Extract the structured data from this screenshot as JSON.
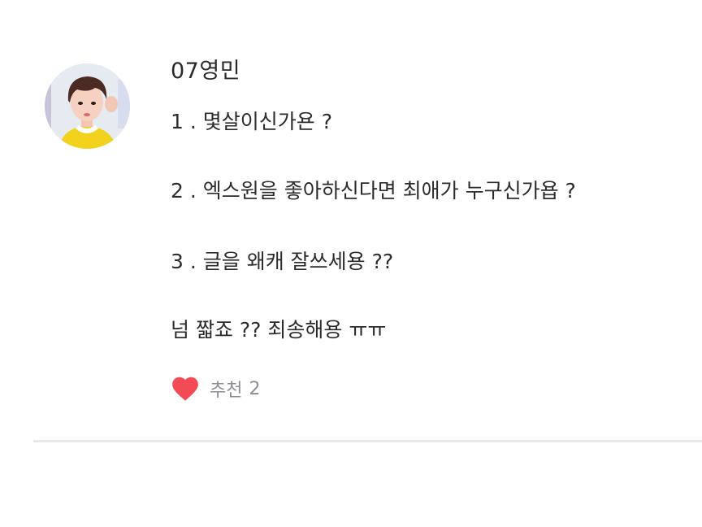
{
  "comment": {
    "username": "07영민",
    "lines": [
      "1 . 몇살이신가욘 ?",
      "2 . 엑스원을 좋아하신다면 최애가 누구신가욥 ?",
      "3 . 글을 왜캐 잘쓰세용 ??",
      "넘 짧죠 ??  죄송해용 ㅠㅠ"
    ],
    "like": {
      "icon": "heart-icon",
      "label": "추천",
      "count": "2",
      "color": "#f24b55"
    }
  }
}
